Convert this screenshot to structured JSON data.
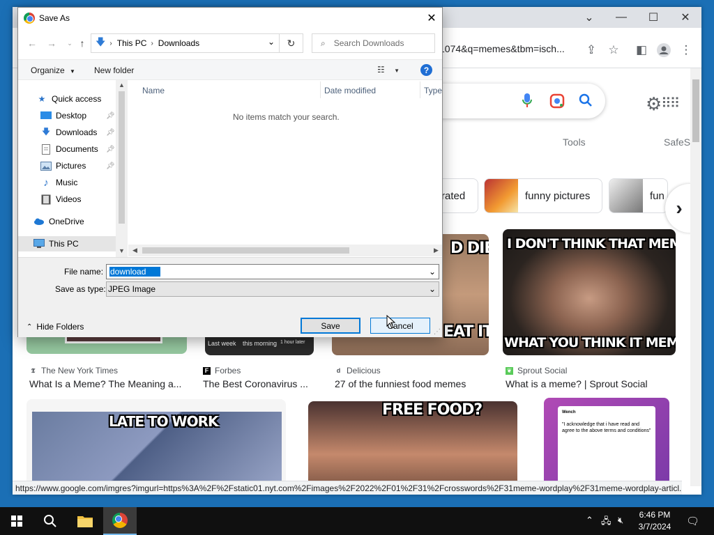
{
  "browser": {
    "url": "1074&q=memes&tbm=isch...",
    "tools_label": "Tools",
    "safesearch_label": "SafeS",
    "chips": [
      {
        "label": "rated"
      },
      {
        "label": "funny pictures"
      },
      {
        "label": "fun"
      }
    ],
    "images": [
      {
        "source": "The New York Times",
        "title": "What Is a Meme? The Meaning a...",
        "thumb_labels": []
      },
      {
        "source": "Forbes",
        "title": "The Best Coronavirus ...",
        "thumb_labels": [
          "Last week",
          "this morning",
          "1 hour later"
        ]
      },
      {
        "source": "Delicious",
        "title": "27 of the funniest food memes",
        "top_text": "D DIET",
        "bottom_text": "EAT IT."
      },
      {
        "source": "Sprout Social",
        "title": "What is a meme? | Sprout Social",
        "top_text": "I DON'T THINK THAT MEMES",
        "bottom_text": "WHAT YOU THINK IT MEMES"
      }
    ],
    "row2": [
      {
        "top_text": "LATE TO WORK"
      },
      {
        "top_text": "FREE FOOD?"
      },
      {
        "tweet_name": "Wench",
        "tweet_text": "\"I acknowledge that i have read and agree to the above terms and conditions\""
      }
    ],
    "status_url": "https://www.google.com/imgres?imgurl=https%3A%2F%2Fstatic01.nyt.com%2Fimages%2F2022%2F01%2F31%2Fcrosswords%2F31meme-wordplay%2F31meme-wordplay-articl..."
  },
  "dialog": {
    "title": "Save As",
    "breadcrumb": [
      "This PC",
      "Downloads"
    ],
    "search_placeholder": "Search Downloads",
    "organize_label": "Organize",
    "new_folder_label": "New folder",
    "help_label": "?",
    "nav_items": [
      {
        "label": "Quick access",
        "icon": "star-icon"
      },
      {
        "label": "Desktop",
        "icon": "desktop-icon",
        "pinned": true
      },
      {
        "label": "Downloads",
        "icon": "download-icon",
        "pinned": true
      },
      {
        "label": "Documents",
        "icon": "documents-icon",
        "pinned": true
      },
      {
        "label": "Pictures",
        "icon": "pictures-icon",
        "pinned": true
      },
      {
        "label": "Music",
        "icon": "music-icon"
      },
      {
        "label": "Videos",
        "icon": "videos-icon"
      },
      {
        "label": "OneDrive",
        "icon": "cloud-icon"
      },
      {
        "label": "This PC",
        "icon": "computer-icon",
        "selected": true
      }
    ],
    "columns": [
      "Name",
      "Date modified",
      "Type"
    ],
    "empty_message": "No items match your search.",
    "file_name_label": "File name:",
    "file_name_value": "download",
    "save_type_label": "Save as type:",
    "save_type_value": "JPEG Image",
    "hide_folders_label": "Hide Folders",
    "save_label": "Save",
    "cancel_label": "Cancel"
  },
  "taskbar": {
    "time": "6:46 PM",
    "date": "3/7/2024"
  },
  "colors": {
    "accent": "#0078d7",
    "desktop": "#1b6fb5",
    "taskbar": "#101010"
  }
}
